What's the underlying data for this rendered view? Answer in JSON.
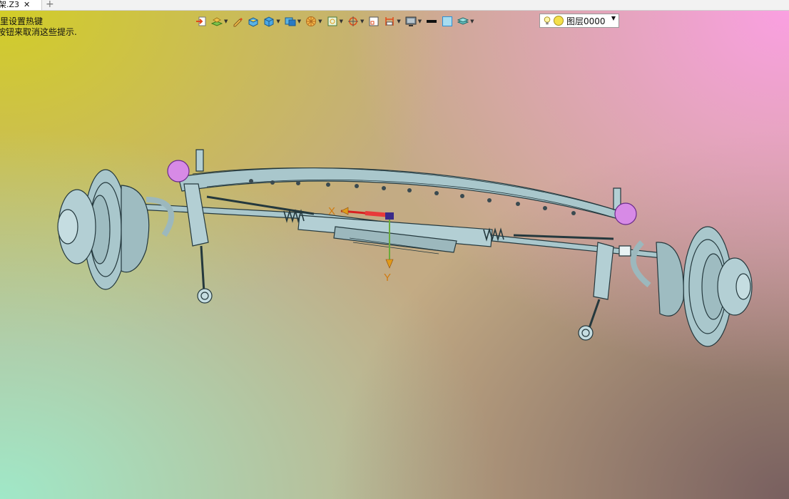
{
  "tab": {
    "title": "架.Z3",
    "close": "✕",
    "add": "+"
  },
  "hints": {
    "line1": "里设置热键",
    "line2": "按钮来取消这些提示."
  },
  "toolbar": {
    "buttons": [
      {
        "icon": "import-icon",
        "has_dropdown": false
      },
      {
        "icon": "layers-icon",
        "has_dropdown": true
      },
      {
        "icon": "pen-icon",
        "has_dropdown": false
      },
      {
        "icon": "block-icon",
        "has_dropdown": false
      },
      {
        "icon": "cube-icon",
        "has_dropdown": true
      },
      {
        "icon": "view-cube-icon",
        "has_dropdown": true
      },
      {
        "icon": "wheel-icon",
        "has_dropdown": true
      },
      {
        "icon": "frame-icon",
        "has_dropdown": true
      },
      {
        "icon": "snap-target-icon",
        "has_dropdown": true
      },
      {
        "icon": "sketch-icon",
        "has_dropdown": false
      },
      {
        "icon": "dimension-icon",
        "has_dropdown": true
      },
      {
        "icon": "display-icon",
        "has_dropdown": true
      },
      {
        "icon": "line-color-icon",
        "has_dropdown": false
      },
      {
        "icon": "fill-color-icon",
        "has_dropdown": false
      },
      {
        "icon": "layer-stack-icon",
        "has_dropdown": true
      }
    ],
    "colors": {
      "line": "#111111",
      "fill": "#a8dcef",
      "accent": "#2a8fd6"
    }
  },
  "layer": {
    "name": "图层0000",
    "dropdown": "▼"
  },
  "triad": {
    "x_label": "X",
    "y_label": "Y"
  },
  "model_colors": {
    "metal": "#a9c7cc",
    "edge": "#24383d",
    "highlight": "#d78ae6"
  }
}
